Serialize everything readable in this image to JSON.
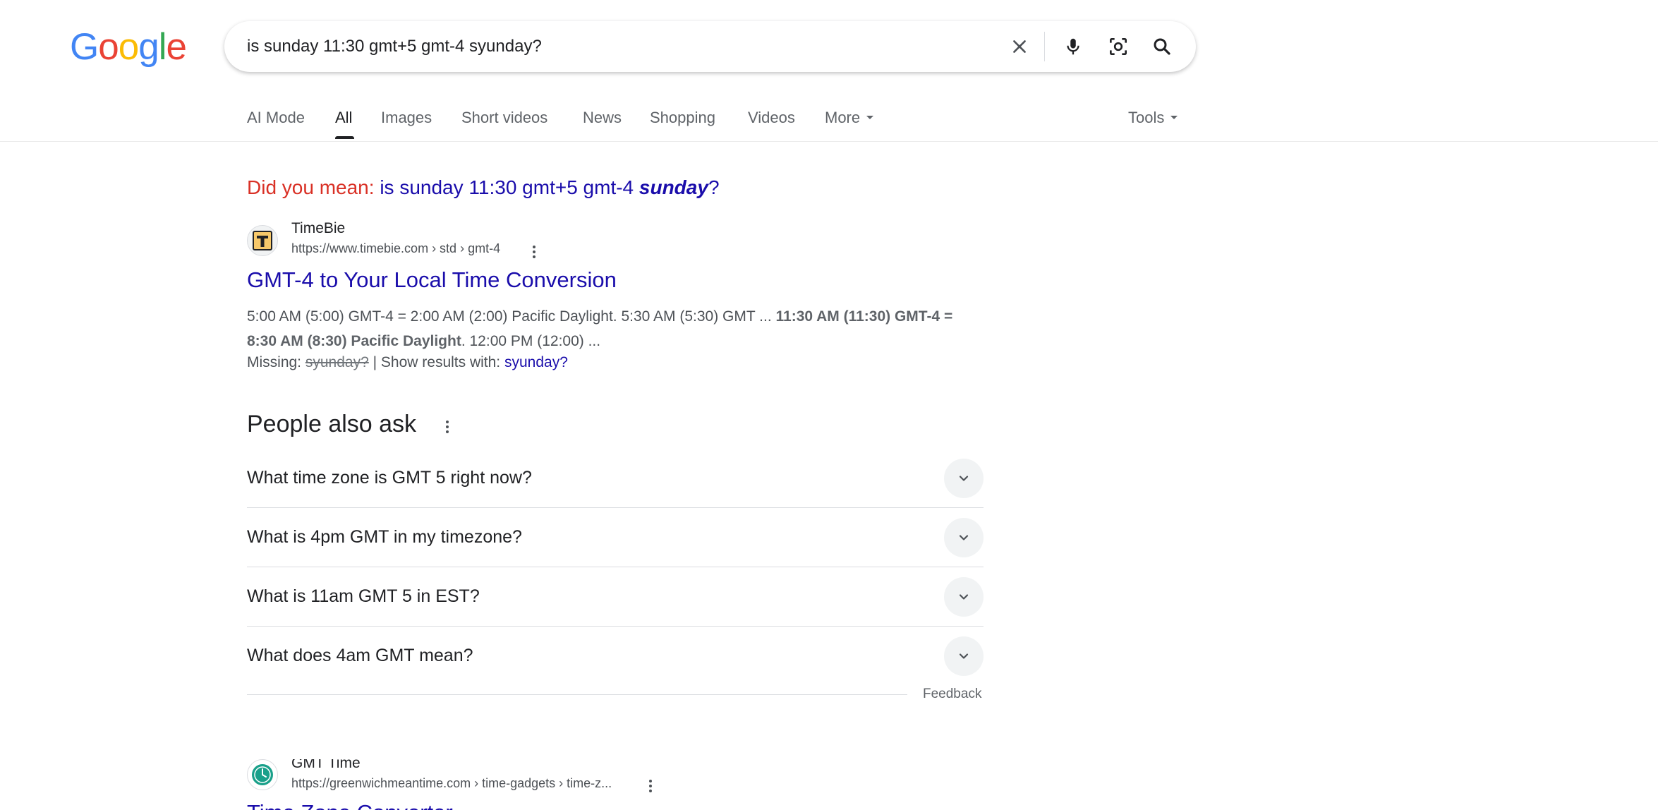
{
  "logo": {
    "letters": [
      "G",
      "o",
      "o",
      "g",
      "l",
      "e"
    ],
    "colors": [
      "#4285F4",
      "#EA4335",
      "#FBBC05",
      "#4285F4",
      "#34A853",
      "#EA4335"
    ]
  },
  "search": {
    "query": "is sunday 11:30 gmt+5 gmt-4 syunday?"
  },
  "tabs": [
    {
      "label": "AI Mode",
      "active": false
    },
    {
      "label": "All",
      "active": true
    },
    {
      "label": "Images",
      "active": false
    },
    {
      "label": "Short videos",
      "active": false
    },
    {
      "label": "News",
      "active": false
    },
    {
      "label": "Shopping",
      "active": false
    },
    {
      "label": "Videos",
      "active": false
    },
    {
      "label": "More",
      "active": false
    }
  ],
  "tools_label": "Tools",
  "did_you_mean": {
    "prefix": "Did you mean:",
    "before": "is sunday 11:30 gmt+5 gmt-4",
    "correction": "sunday",
    "after": "?"
  },
  "results": [
    {
      "site_name": "TimeBie",
      "url": "https://www.timebie.com › std › gmt-4",
      "favicon_letter": "T",
      "title": "GMT-4 to Your Local Time Conversion",
      "snippet_plain_1": "5:00 AM (5:00) GMT-4 = 2:00 AM (2:00) Pacific Daylight. 5:30 AM (5:30) GMT ... ",
      "snippet_bold": "11:30 AM (11:30) GMT-4 = 8:30 AM (8:30) Pacific Daylight",
      "snippet_plain_2": ". 12:00 PM (12:00) ...",
      "missing_label": "Missing:",
      "missing_term": "syunday?",
      "show_results_label": "| Show results with:",
      "show_results_link": "syunday?"
    },
    {
      "site_name": "GMT Time",
      "url": "https://greenwichmeantime.com › time-gadgets › time-z...",
      "title": "Time Zone Converter"
    }
  ],
  "people_also_ask": {
    "title": "People also ask",
    "questions": [
      "What time zone is GMT 5 right now?",
      "What is 4pm GMT in my timezone?",
      "What is 11am GMT 5 in EST?",
      "What does 4am GMT mean?"
    ],
    "feedback_label": "Feedback"
  },
  "colors": {
    "link": "#1a0dab",
    "did_you_mean": "#d93025",
    "text": "#202124",
    "muted": "#4d5156"
  }
}
